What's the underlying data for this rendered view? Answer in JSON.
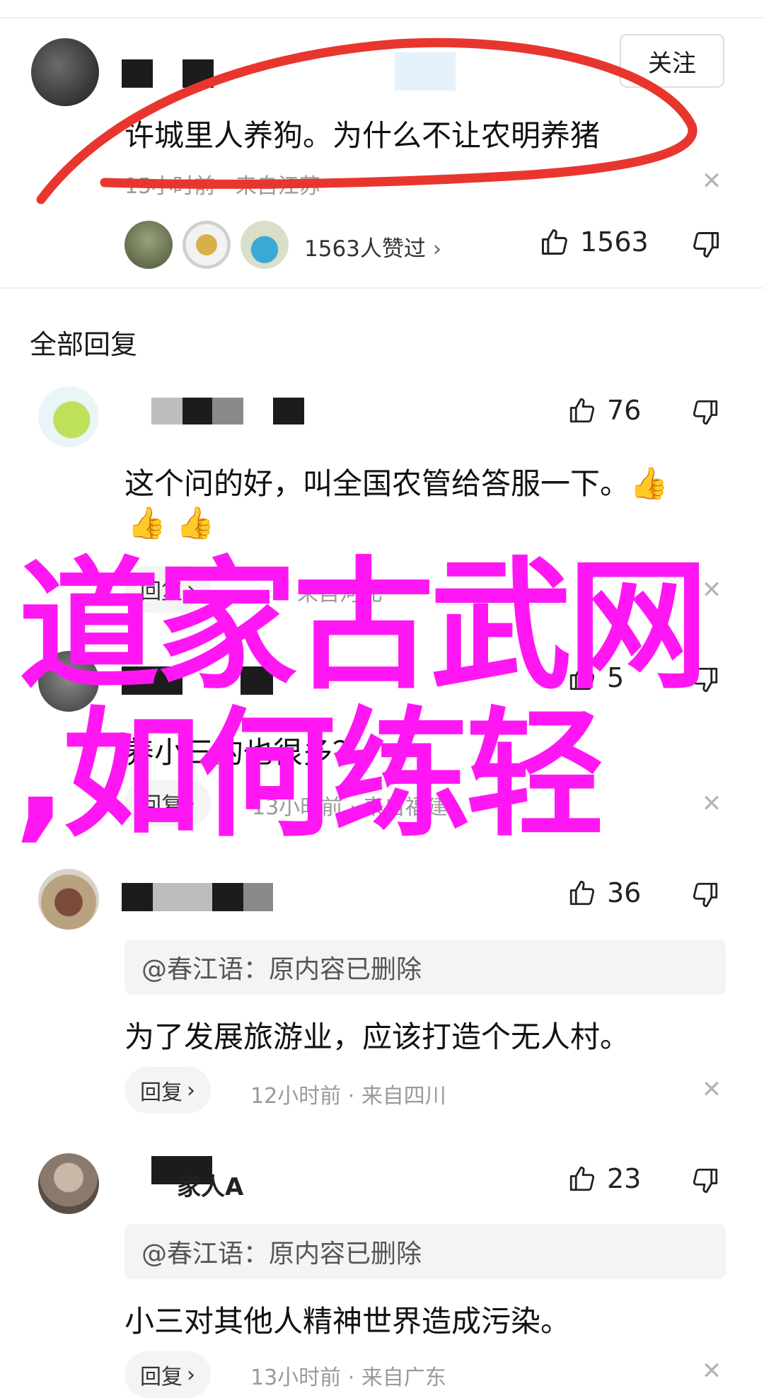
{
  "comment": {
    "follow_label": "关注",
    "text": "许城里人养狗。为什么不让农明养猪",
    "time": "15小时前",
    "location": "来自江苏",
    "likers_text": "1563人赞过",
    "like_count": "1563"
  },
  "section_title": "全部回复",
  "reply_label": "回复",
  "replies": [
    {
      "like_count": "76",
      "text": "这个问的好，叫全国农管给答服一下。",
      "time": "",
      "location": "来自河北"
    },
    {
      "like_count": "5",
      "text": "养小三的也很多？",
      "time": "13小时前",
      "location": "来自福建"
    },
    {
      "like_count": "36",
      "quote": "@春江语：原内容已删除",
      "text": "为了发展旅游业，应该打造个无人村。",
      "time": "12小时前",
      "location": "来自四川"
    },
    {
      "username": "家人A",
      "like_count": "23",
      "quote": "@春江语：原内容已删除",
      "text": "小三对其他人精神世界造成污染。",
      "time": "13小时前",
      "location": "来自广东"
    }
  ],
  "overlay": {
    "line1": "道家古武网",
    "line2": ",如何练轻"
  },
  "colors": {
    "overlay": "#ff17f3",
    "annotation_red": "#e8362f",
    "meta_gray": "#9a9a9a",
    "pill_bg": "#f4f4f4"
  },
  "icons": [
    "thumbs-up-icon",
    "thumbs-down-icon",
    "close-icon",
    "chevron-right-icon",
    "thumbs-up-emoji"
  ]
}
